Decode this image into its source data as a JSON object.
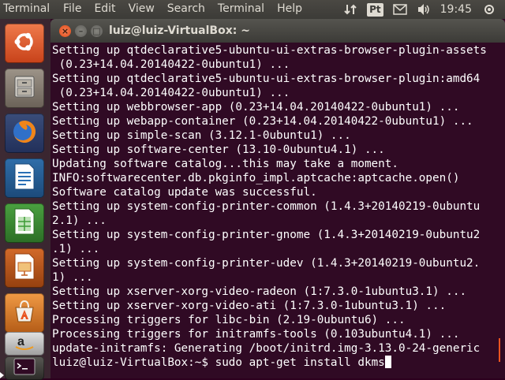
{
  "top_panel": {
    "app_name": "Terminal",
    "menu": [
      "File",
      "Edit",
      "View",
      "Search",
      "Terminal",
      "Help"
    ],
    "keyboard_indicator": "Pt",
    "clock": "19:45"
  },
  "launcher": {
    "items": [
      {
        "name": "Dash home",
        "icon": "ubuntu-logo-icon",
        "color": "#e95420"
      },
      {
        "name": "Files",
        "icon": "files-icon",
        "color": "#8a7f72"
      },
      {
        "name": "Firefox",
        "icon": "firefox-icon",
        "color": "#e66000"
      },
      {
        "name": "LibreOffice Writer",
        "icon": "writer-icon",
        "color": "#2a6fb5"
      },
      {
        "name": "LibreOffice Calc",
        "icon": "calc-icon",
        "color": "#3d9b35"
      },
      {
        "name": "LibreOffice Impress",
        "icon": "impress-icon",
        "color": "#c05b1f"
      },
      {
        "name": "Ubuntu Software Center",
        "icon": "software-center-icon",
        "color": "#e48a2c"
      },
      {
        "name": "Amazon",
        "icon": "amazon-icon",
        "color": "#c9c9c9"
      },
      {
        "name": "Terminal",
        "icon": "terminal-icon",
        "color": "#3c3b37"
      }
    ]
  },
  "window": {
    "title": "luiz@luiz-VirtualBox: ~"
  },
  "terminal": {
    "lines": [
      "Setting up qtdeclarative5-ubuntu-ui-extras-browser-plugin-assets",
      " (0.23+14.04.20140422-0ubuntu1) ...",
      "Setting up qtdeclarative5-ubuntu-ui-extras-browser-plugin:amd64",
      " (0.23+14.04.20140422-0ubuntu1) ...",
      "Setting up webbrowser-app (0.23+14.04.20140422-0ubuntu1) ...",
      "Setting up webapp-container (0.23+14.04.20140422-0ubuntu1) ...",
      "Setting up simple-scan (3.12.1-0ubuntu1) ...",
      "Setting up software-center (13.10-0ubuntu4.1) ...",
      "Updating software catalog...this may take a moment.",
      "INFO:softwarecenter.db.pkginfo_impl.aptcache:aptcache.open()",
      "Software catalog update was successful.",
      "Setting up system-config-printer-common (1.4.3+20140219-0ubuntu",
      "2.1) ...",
      "Setting up system-config-printer-gnome (1.4.3+20140219-0ubuntu2",
      ".1) ...",
      "Setting up system-config-printer-udev (1.4.3+20140219-0ubuntu2.",
      "1) ...",
      "Setting up xserver-xorg-video-radeon (1:7.3.0-1ubuntu3.1) ...",
      "Setting up xserver-xorg-video-ati (1:7.3.0-1ubuntu3.1) ...",
      "Processing triggers for libc-bin (2.19-0ubuntu6) ...",
      "Processing triggers for initramfs-tools (0.103ubuntu4.1) ...",
      "update-initramfs: Generating /boot/initrd.img-3.13.0-24-generic"
    ],
    "prompt": "luiz@luiz-VirtualBox:~$ ",
    "command": "sudo apt-get install dkms"
  }
}
